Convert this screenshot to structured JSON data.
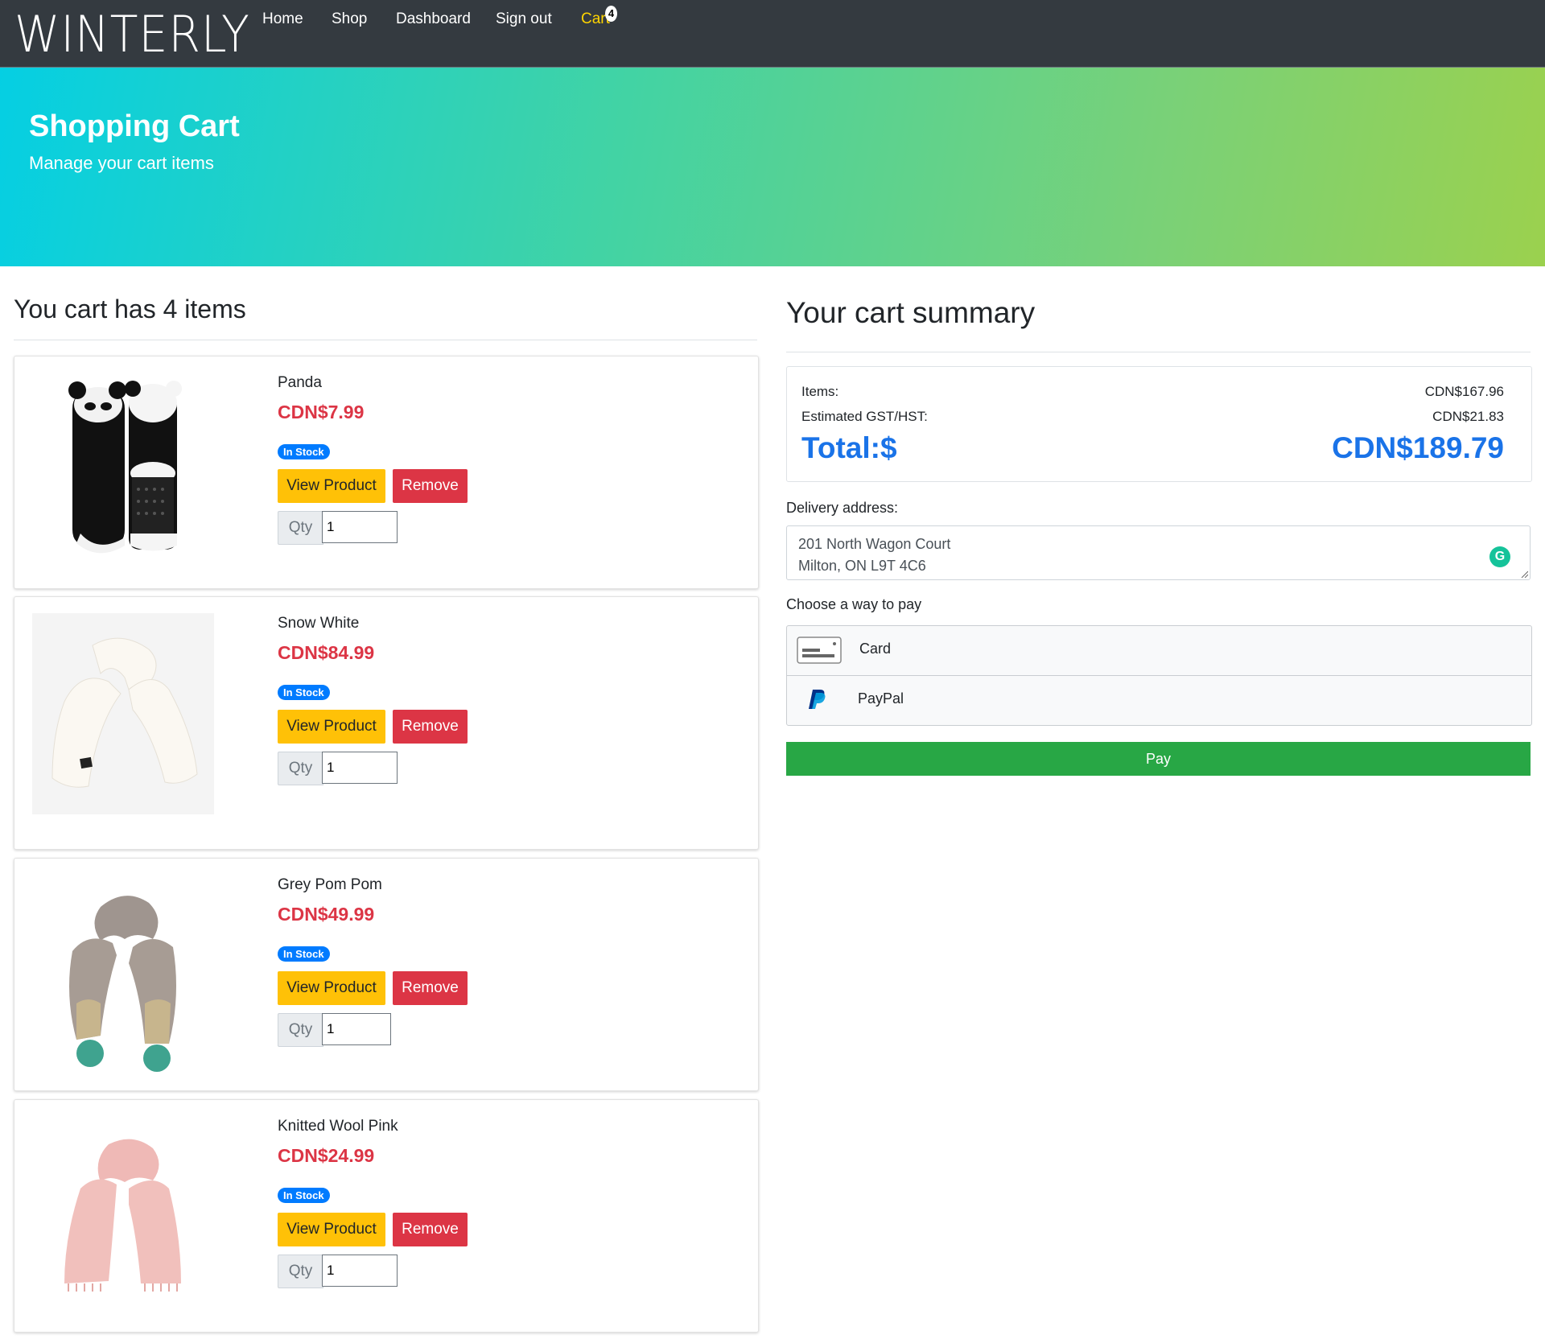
{
  "nav": {
    "brand": "WINTERLY",
    "links": [
      "Home",
      "Shop",
      "Dashboard",
      "Sign out"
    ],
    "cart_label": "Cart",
    "cart_count": "4"
  },
  "hero": {
    "title": "Shopping Cart",
    "subtitle": "Manage your cart items"
  },
  "cart": {
    "heading": "You cart has 4 items",
    "stock_badge": "In Stock",
    "view_label": "View Product",
    "remove_label": "Remove",
    "qty_label": "Qty",
    "items": [
      {
        "name": "Panda",
        "price": "CDN$7.99",
        "qty": "1",
        "image_icon": "panda-socks"
      },
      {
        "name": "Snow White",
        "price": "CDN$84.99",
        "qty": "1",
        "image_icon": "white-scarf"
      },
      {
        "name": "Grey Pom Pom",
        "price": "CDN$49.99",
        "qty": "1",
        "image_icon": "grey-pompom-scarf"
      },
      {
        "name": "Knitted Wool Pink",
        "price": "CDN$24.99",
        "qty": "1",
        "image_icon": "pink-scarf"
      }
    ]
  },
  "summary": {
    "heading": "Your cart summary",
    "items_label": "Items:",
    "items_value": "CDN$167.96",
    "tax_label": "Estimated GST/HST:",
    "tax_value": "CDN$21.83",
    "total_label": "Total:$",
    "total_value": "CDN$189.79",
    "delivery_label": "Delivery address:",
    "address_line1": "201 North Wagon Court",
    "address_line2": "Milton, ON L9T 4C6",
    "pay_choice_label": "Choose a way to pay",
    "pay_options": [
      {
        "label": "Card",
        "icon": "credit-card-icon"
      },
      {
        "label": "PayPal",
        "icon": "paypal-icon"
      }
    ],
    "pay_button": "Pay"
  },
  "colors": {
    "navbar": "#343a40",
    "price": "#dc3545",
    "accent_blue": "#1a73e8",
    "badge": "#007bff",
    "view_button": "#ffc107",
    "remove_button": "#dc3545",
    "pay_button": "#28a745"
  }
}
